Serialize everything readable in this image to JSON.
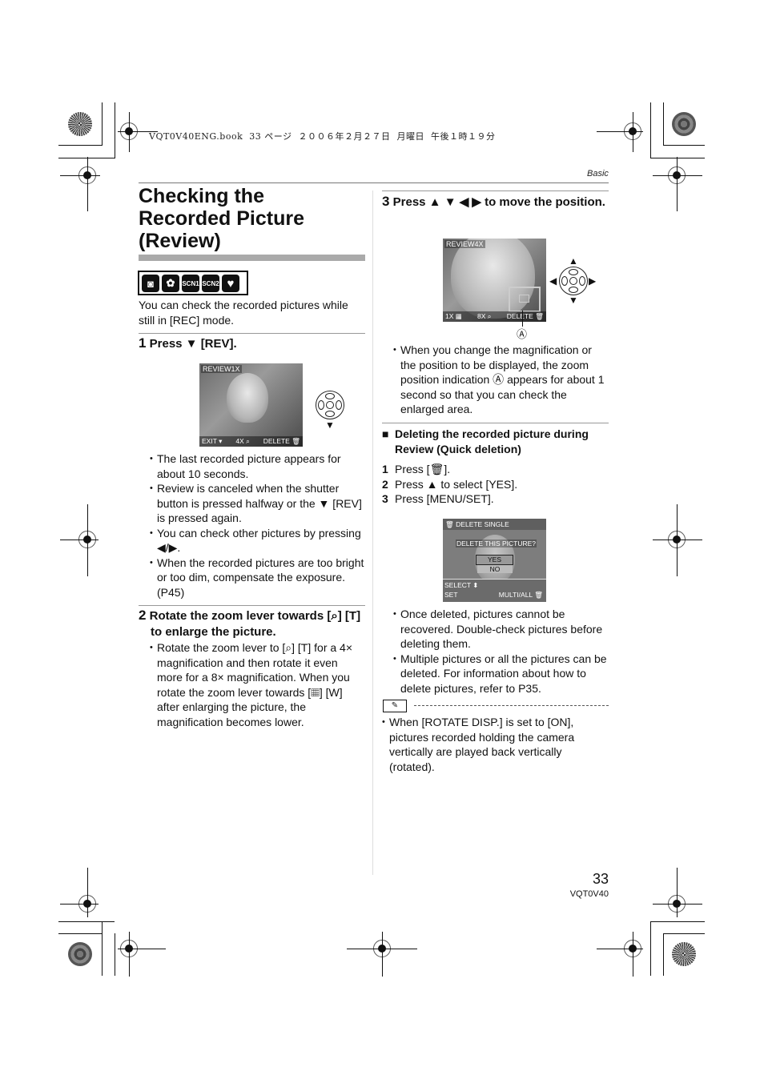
{
  "print_header": "VQT0V40ENG.book  33 ページ  ２００６年２月２７日  月曜日  午後１時１９分",
  "section_label": "Basic",
  "title": "Checking the Recorded Picture (Review)",
  "title_lines": [
    "Checking the",
    "Recorded Picture",
    "(Review)"
  ],
  "mode_icons": [
    {
      "name": "camera-mode-icon",
      "label": "◙"
    },
    {
      "name": "macro-mode-icon",
      "label": "✿"
    },
    {
      "name": "scn1-mode-icon",
      "label": "SCN1"
    },
    {
      "name": "scn2-mode-icon",
      "label": "SCN2"
    },
    {
      "name": "heart-mode-icon",
      "label": "♥"
    }
  ],
  "intro": "You can check the recorded pictures while still in [REC] mode.",
  "step1": {
    "num": "1",
    "text": "Press ▼ [REV].",
    "screen": {
      "top": "REVIEW1X",
      "bottom_left": "EXIT ▾",
      "bottom_mid": "4X ⌕",
      "bottom_right": "DELETE 🗑"
    },
    "bullets": [
      "The last recorded picture appears for about 10 seconds.",
      "Review is canceled when the shutter button is pressed halfway or the ▼ [REV] is pressed again.",
      "You can check other pictures by pressing ◀/▶.",
      "When the recorded pictures are too bright or too dim, compensate the exposure. (P45)"
    ]
  },
  "step2": {
    "num": "2",
    "text": "Rotate the zoom lever towards [⌕] [T] to enlarge the picture.",
    "bullets": [
      "Rotate the zoom lever to [⌕] [T] for a 4× magnification and then rotate it even more for a 8× magnification. When you rotate the zoom lever towards [▦] [W] after enlarging the picture, the magnification becomes lower."
    ]
  },
  "step3": {
    "num": "3",
    "text": "Press ▲ ▼ ◀ ▶ to move the position.",
    "screen": {
      "top": "REVIEW4X",
      "bottom_left": "1X ▦",
      "bottom_mid": "8X ⌕",
      "bottom_right": "DELETE 🗑"
    },
    "callout": "Ⓐ",
    "bullets": [
      "When you change the magnification or the position to be displayed, the zoom position indication Ⓐ appears for about 1 second so that you can check the enlarged area."
    ]
  },
  "quick_delete": {
    "heading": "Deleting the recorded picture during Review (Quick deletion)",
    "steps": [
      {
        "n": "1",
        "text": "Press [🗑]."
      },
      {
        "n": "2",
        "text": "Press ▲ to select [YES]."
      },
      {
        "n": "3",
        "text": "Press [MENU/SET]."
      }
    ],
    "screen": {
      "header": "DELETE SINGLE",
      "question": "DELETE THIS PICTURE?",
      "yes": "YES",
      "no": "NO",
      "select": "SELECT ⬍",
      "set": "SET",
      "multi": "MULTI/ALL 🗑"
    },
    "bullets": [
      "Once deleted, pictures cannot be recovered. Double-check pictures before deleting them.",
      "Multiple pictures or all the pictures can be deleted. For information about how to delete pictures, refer to P35."
    ]
  },
  "note": {
    "icon": "✎",
    "text": "When [ROTATE DISP.] is set to [ON], pictures recorded holding the camera vertically are played back vertically (rotated)."
  },
  "footer": {
    "page": "33",
    "code": "VQT0V40"
  }
}
